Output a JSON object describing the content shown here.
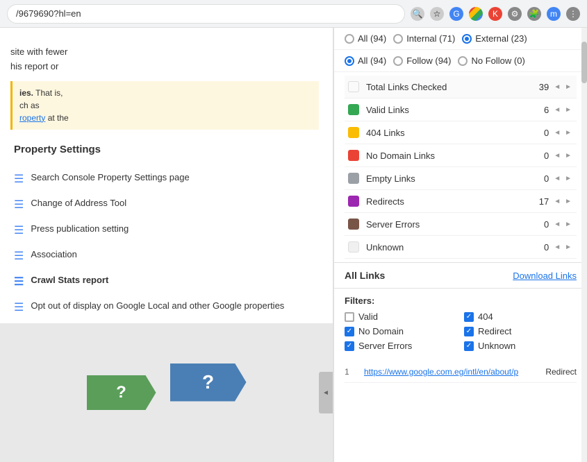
{
  "browser": {
    "address": "/9679690?hl=en",
    "icons": [
      "search",
      "star",
      "google",
      "chrome",
      "red",
      "gear",
      "puzzle",
      "user",
      "more"
    ]
  },
  "left_panel": {
    "text_lines": [
      "site with fewer",
      "his report or"
    ],
    "bold_text": "ies.",
    "description": "That is,",
    "sub_text": "ch as",
    "link_text": "roperty",
    "link_suffix": " at the",
    "note_bold": "ies.",
    "property_settings": {
      "title": "Property Settings",
      "menu_items": [
        {
          "id": "search-console",
          "label": "Search Console Property Settings page"
        },
        {
          "id": "change-address",
          "label": "Change of Address Tool"
        },
        {
          "id": "press-publication",
          "label": "Press publication setting"
        },
        {
          "id": "association",
          "label": "Association"
        },
        {
          "id": "crawl-stats",
          "label": "Crawl Stats report",
          "active": true
        },
        {
          "id": "opt-out",
          "label": "Opt out of display on Google Local and other Google properties"
        }
      ]
    }
  },
  "right_panel": {
    "filter_rows": [
      {
        "options": [
          {
            "id": "all-94-top",
            "label": "All (94)",
            "selected": false
          },
          {
            "id": "internal-71",
            "label": "Internal (71)",
            "selected": false
          },
          {
            "id": "external-23",
            "label": "External (23)",
            "selected": true
          }
        ]
      },
      {
        "options": [
          {
            "id": "all-94-bottom",
            "label": "All (94)",
            "selected": true
          },
          {
            "id": "follow-94",
            "label": "Follow (94)",
            "selected": false
          },
          {
            "id": "nofollow-0",
            "label": "No Follow (0)",
            "selected": false
          }
        ]
      }
    ],
    "stats": {
      "total_label": "Total Links Checked",
      "total_value": "39",
      "rows": [
        {
          "id": "valid",
          "color": "#34a853",
          "label": "Valid Links",
          "value": "6"
        },
        {
          "id": "404",
          "color": "#fbbc05",
          "label": "404 Links",
          "value": "0"
        },
        {
          "id": "no-domain",
          "color": "#ea4335",
          "label": "No Domain Links",
          "value": "0"
        },
        {
          "id": "empty",
          "color": "#9aa0a6",
          "label": "Empty Links",
          "value": "0"
        },
        {
          "id": "redirects",
          "color": "#9c27b0",
          "label": "Redirects",
          "value": "17"
        },
        {
          "id": "server-errors",
          "color": "#795548",
          "label": "Server Errors",
          "value": "0"
        },
        {
          "id": "unknown",
          "color": "#f5f5f5",
          "label": "Unknown",
          "value": "0"
        }
      ]
    },
    "all_links": {
      "title": "All Links",
      "download_label": "Download Links"
    },
    "filters": {
      "title": "Filters:",
      "items": [
        {
          "id": "valid",
          "label": "Valid",
          "checked": false
        },
        {
          "id": "404",
          "label": "404",
          "checked": true
        },
        {
          "id": "no-domain",
          "label": "No Domain",
          "checked": true
        },
        {
          "id": "redirect",
          "label": "Redirect",
          "checked": true
        },
        {
          "id": "server-errors",
          "label": "Server Errors",
          "checked": true
        },
        {
          "id": "unknown",
          "label": "Unknown",
          "checked": true
        }
      ]
    },
    "links": [
      {
        "number": "1",
        "url": "https://www.google.com.eg/intl/en/about/p",
        "type": "Redirect"
      }
    ]
  }
}
